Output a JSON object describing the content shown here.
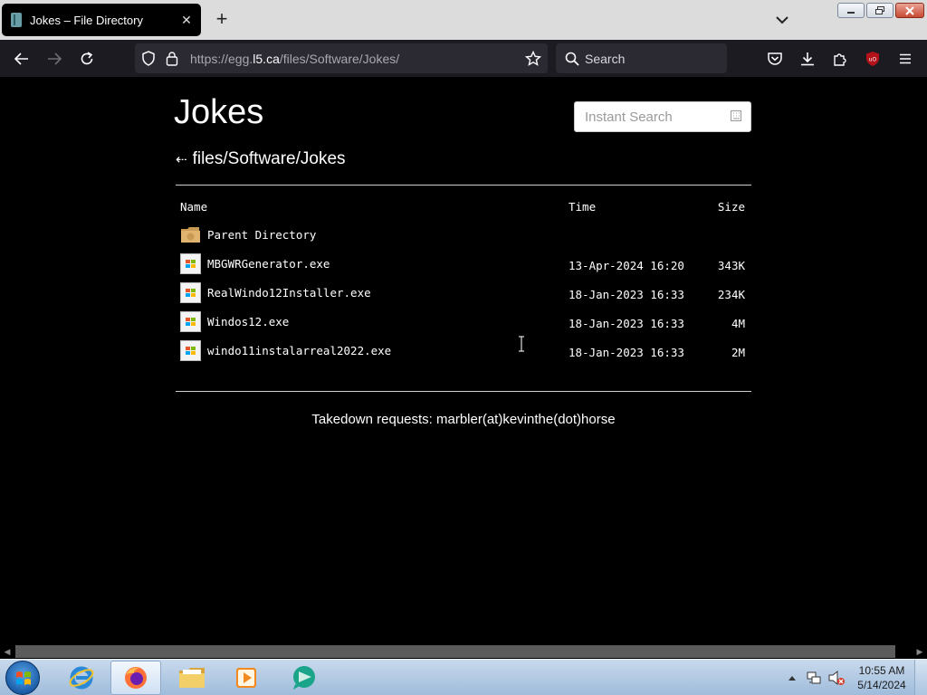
{
  "browser": {
    "tab_title": "Jokes – File Directory",
    "tab_close": "✕",
    "new_tab": "+",
    "url_prefix": "https://egg.",
    "url_host": "l5.ca",
    "url_path": "/files/Software/Jokes/",
    "search_placeholder": "Search"
  },
  "page": {
    "title": "Jokes",
    "instant_search_placeholder": "Instant Search",
    "back_arrow": "⇠",
    "breadcrumb": "files/Software/Jokes",
    "columns": {
      "name": "Name",
      "time": "Time",
      "size": "Size"
    },
    "entries": [
      {
        "name": "Parent Directory",
        "time": "",
        "size": "",
        "type": "folder"
      },
      {
        "name": "MBGWRGenerator.exe",
        "time": "13-Apr-2024 16:20",
        "size": "343K",
        "type": "exe"
      },
      {
        "name": "RealWindo12Installer.exe",
        "time": "18-Jan-2023 16:33",
        "size": "234K",
        "type": "exe"
      },
      {
        "name": "Windos12.exe",
        "time": "18-Jan-2023 16:33",
        "size": "4M",
        "type": "exe"
      },
      {
        "name": "windo11instalarreal2022.exe",
        "time": "18-Jan-2023 16:33",
        "size": "2M",
        "type": "exe"
      }
    ],
    "footer": "Takedown requests: marbler(at)kevinthe(dot)horse"
  },
  "taskbar": {
    "clock_time": "10:55 AM",
    "clock_date": "5/14/2024"
  },
  "colors": {
    "page_bg": "#000000",
    "toolbar_bg": "#1c1b22",
    "urlbar_bg": "#2b2a33",
    "tabstrip_bg": "#dcdcdc",
    "ublock_red": "#b3121b"
  }
}
